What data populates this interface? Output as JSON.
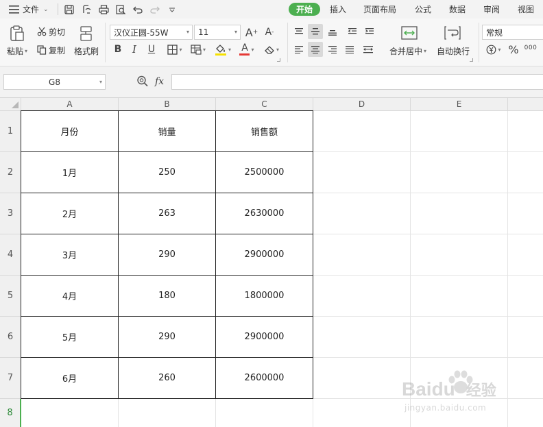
{
  "menubar": {
    "file_label": "文件",
    "tabs": [
      {
        "label": "开始",
        "active": true
      },
      {
        "label": "插入"
      },
      {
        "label": "页面布局"
      },
      {
        "label": "公式"
      },
      {
        "label": "数据"
      },
      {
        "label": "审阅"
      },
      {
        "label": "视图"
      }
    ]
  },
  "ribbon": {
    "paste": "粘贴",
    "cut": "剪切",
    "copy": "复制",
    "format_painter": "格式刷",
    "font_name": "汉仪正圆-55W",
    "font_size": "11",
    "merge_center": "合并居中",
    "wrap_text": "自动换行",
    "number_format": "常规",
    "bold": "B",
    "italic": "I",
    "underline": "U",
    "font_color_letter": "A",
    "percent": "%",
    "thousands": "000"
  },
  "formula_bar": {
    "cell_ref": "G8",
    "fx_label": "fx",
    "formula_value": ""
  },
  "sheet": {
    "columns": [
      "A",
      "B",
      "C",
      "D",
      "E"
    ],
    "rows": [
      {
        "num": "1",
        "cells": [
          "月份",
          "销量",
          "销售额"
        ]
      },
      {
        "num": "2",
        "cells": [
          "1月",
          "250",
          "2500000"
        ]
      },
      {
        "num": "3",
        "cells": [
          "2月",
          "263",
          "2630000"
        ]
      },
      {
        "num": "4",
        "cells": [
          "3月",
          "290",
          "2900000"
        ]
      },
      {
        "num": "5",
        "cells": [
          "4月",
          "180",
          "1800000"
        ]
      },
      {
        "num": "6",
        "cells": [
          "5月",
          "290",
          "2900000"
        ]
      },
      {
        "num": "7",
        "cells": [
          "6月",
          "260",
          "2600000"
        ]
      },
      {
        "num": "8",
        "cells": [
          "",
          "",
          ""
        ]
      }
    ],
    "selected_row": "8"
  },
  "watermark": {
    "brand": "Baidu",
    "cn": "经验",
    "url": "jingyan.baidu.com"
  },
  "colors": {
    "accent": "#4caf50",
    "font_color_bar": "#e53935",
    "fill_color_bar": "#f5e000"
  }
}
